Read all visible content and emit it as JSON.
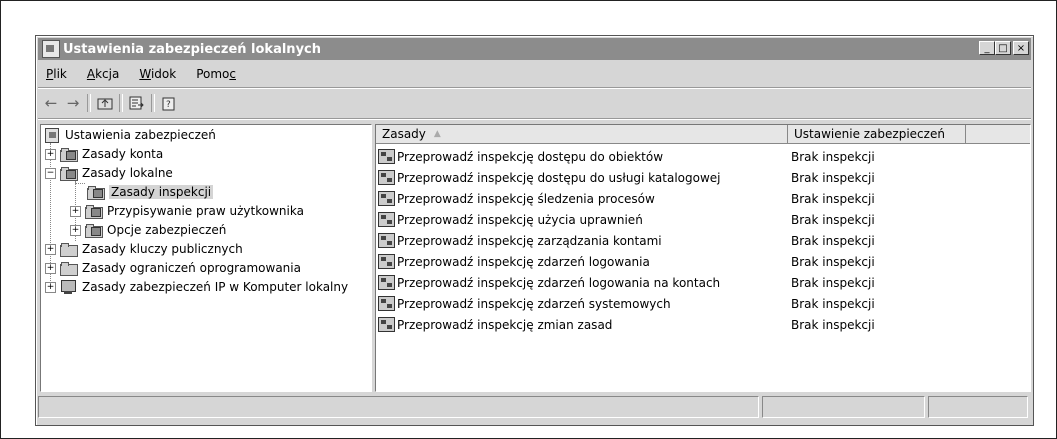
{
  "window": {
    "title": "Ustawienia zabezpieczeń lokalnych",
    "controls": {
      "minimize": "_",
      "maximize": "□",
      "close": "×"
    }
  },
  "menu": [
    {
      "pre": "",
      "key": "P",
      "post": "lik"
    },
    {
      "pre": "",
      "key": "A",
      "post": "kcja"
    },
    {
      "pre": "",
      "key": "W",
      "post": "idok"
    },
    {
      "pre": "Pomo",
      "key": "c",
      "post": ""
    }
  ],
  "toolbar": [
    "back-icon",
    "forward-icon",
    "up-folder-icon",
    "export-list-icon",
    "help-icon"
  ],
  "tree": {
    "root": "Ustawienia zabezpieczeń",
    "items": [
      {
        "label": "Zasady konta",
        "expander": "+"
      },
      {
        "label": "Zasady lokalne",
        "expander": "−"
      },
      {
        "label": "Zasady inspekcji",
        "expander": ""
      },
      {
        "label": "Przypisywanie praw użytkownika",
        "expander": "+"
      },
      {
        "label": "Opcje zabezpieczeń",
        "expander": "+"
      },
      {
        "label": "Zasady kluczy publicznych",
        "expander": "+"
      },
      {
        "label": "Zasady ograniczeń oprogramowania",
        "expander": "+"
      },
      {
        "label": "Zasady zabezpieczeń IP w Komputer lokalny",
        "expander": "+"
      }
    ]
  },
  "list": {
    "columns": [
      "Zasady",
      "Ustawienie zabezpieczeń"
    ],
    "sort_indicator": "▲",
    "rows": [
      {
        "name": "Przeprowadź inspekcję dostępu do obiektów",
        "value": "Brak inspekcji"
      },
      {
        "name": "Przeprowadź inspekcję dostępu do usługi katalogowej",
        "value": "Brak inspekcji"
      },
      {
        "name": "Przeprowadź inspekcję śledzenia procesów",
        "value": "Brak inspekcji"
      },
      {
        "name": "Przeprowadź inspekcję użycia uprawnień",
        "value": "Brak inspekcji"
      },
      {
        "name": "Przeprowadź inspekcję zarządzania kontami",
        "value": "Brak inspekcji"
      },
      {
        "name": "Przeprowadź inspekcję zdarzeń logowania",
        "value": "Brak inspekcji"
      },
      {
        "name": "Przeprowadź inspekcję zdarzeń logowania na kontach",
        "value": "Brak inspekcji"
      },
      {
        "name": "Przeprowadź inspekcję zdarzeń systemowych",
        "value": "Brak inspekcji"
      },
      {
        "name": "Przeprowadź inspekcję zmian zasad",
        "value": "Brak inspekcji"
      }
    ]
  }
}
